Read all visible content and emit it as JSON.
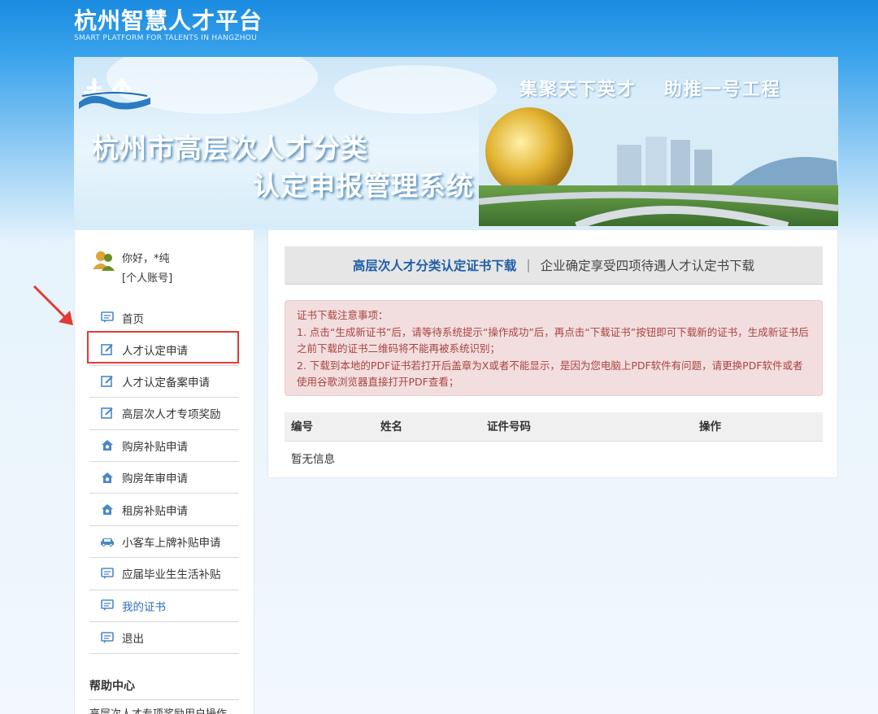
{
  "header": {
    "title": "杭州智慧人才平台",
    "subtitle": "SMART PLATFORM FOR TALENTS IN HANGZHOU"
  },
  "banner": {
    "slogan": "集聚天下英才　 助推一号工程",
    "title_line1": "杭州市高层次人才分类",
    "title_line2": "认定申报管理系统"
  },
  "user": {
    "greeting": "你好，*纯",
    "account": "[个人账号]"
  },
  "menu": {
    "items": [
      {
        "label": "首页",
        "icon": "message-icon"
      },
      {
        "label": "人才认定申请",
        "icon": "edit-icon"
      },
      {
        "label": "人才认定备案申请",
        "icon": "edit-icon"
      },
      {
        "label": "高层次人才专项奖励",
        "icon": "edit-icon"
      },
      {
        "label": "购房补贴申请",
        "icon": "house-icon"
      },
      {
        "label": "购房年审申请",
        "icon": "house-icon"
      },
      {
        "label": "租房补贴申请",
        "icon": "house-icon"
      },
      {
        "label": "小客车上牌补贴申请",
        "icon": "car-icon"
      },
      {
        "label": "应届毕业生生活补贴",
        "icon": "message-icon"
      },
      {
        "label": "我的证书",
        "icon": "message-icon"
      },
      {
        "label": "退出",
        "icon": "message-icon"
      }
    ]
  },
  "help": {
    "title": "帮助中心",
    "item": "高层次人才专项奖励用户操作"
  },
  "tabs": {
    "active": "高层次人才分类认定证书下载",
    "separator": "|",
    "inactive": "企业确定享受四项待遇人才认定书下载"
  },
  "notice": {
    "title": "证书下载注意事项：",
    "line1": "1. 点击“生成新证书”后，请等待系统提示“操作成功”后，再点击“下载证书”按钮即可下载新的证书，生成新证书后之前下载的证书二维码将不能再被系统识别；",
    "line2": "2. 下载到本地的PDF证书若打开后盖章为X或者不能显示，是因为您电脑上PDF软件有问题，请更换PDF软件或者使用谷歌浏览器直接打开PDF查看；"
  },
  "table": {
    "columns": [
      "编号",
      "姓名",
      "证件号码",
      "操作"
    ],
    "empty_text": "暂无信息"
  },
  "colors": {
    "header_blue": "#1a8be0",
    "active_tab": "#1f5fa8",
    "notice_bg": "#f2dede",
    "notice_text": "#a94442",
    "highlight_red": "#e53935"
  }
}
